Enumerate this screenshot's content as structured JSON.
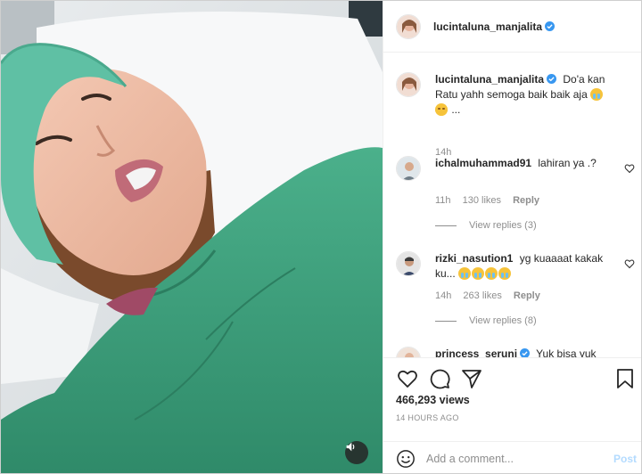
{
  "post": {
    "username": "lucintaluna_manjalita",
    "views": "466,293 views",
    "timestamp": "14 HOURS AGO"
  },
  "comments": [
    {
      "username": "lucintaluna_manjalita",
      "text": "Do'a kan Ratu yahh semoga baik baik aja",
      "suffix": "...",
      "time": "14h"
    },
    {
      "username": "ichalmuhammad91",
      "text": "lahiran ya .?",
      "time": "11h",
      "likes": "130 likes",
      "reply": "Reply",
      "view_replies": "View replies (3)"
    },
    {
      "username": "rizki_nasution1",
      "text": "yg kuaaaat kakak ku...",
      "time": "14h",
      "likes": "263 likes",
      "reply": "Reply",
      "view_replies": "View replies (8)"
    },
    {
      "username": "princess_seruni",
      "text": "Yuk bisa yuk"
    }
  ],
  "composer": {
    "placeholder": "Add a comment...",
    "post_label": "Post"
  },
  "icons": {
    "like": "heart-icon",
    "comment": "comment-icon",
    "share": "paper-plane-icon",
    "save": "bookmark-icon",
    "emoji": "smile-icon",
    "mute": "speaker-icon",
    "verified": "verified-badge-icon"
  },
  "colors": {
    "verified": "#3897f0",
    "post_disabled": "#b3dbff",
    "muted_text": "#8e8e8e",
    "scrub_green": "#3f9a7a"
  }
}
